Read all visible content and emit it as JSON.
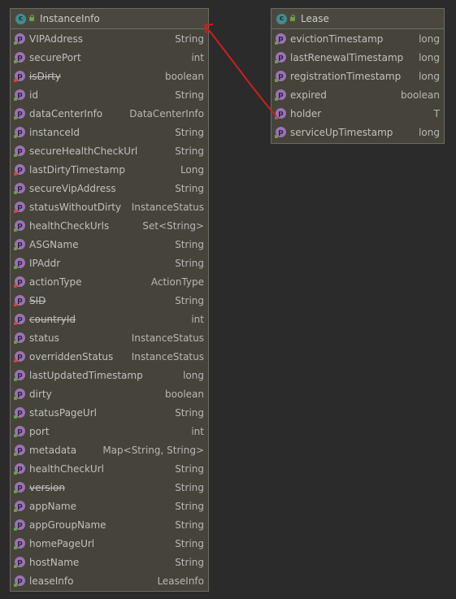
{
  "colors": {
    "background": "#2b2b2b",
    "class_box": "#45433a",
    "border": "#6d6c63",
    "class_icon": "#3d8d93",
    "property_icon": "#9a73b3",
    "arrow": "#c8201f"
  },
  "class_icon_letter": "c",
  "property_icon_letter": "p",
  "instance_info": {
    "title": "InstanceInfo",
    "fields": [
      {
        "name": "VIPAddress",
        "type": "String",
        "access": "public",
        "deprecated": false
      },
      {
        "name": "securePort",
        "type": "int",
        "access": "public",
        "deprecated": false
      },
      {
        "name": "isDirty",
        "type": "boolean",
        "access": "private",
        "deprecated": true
      },
      {
        "name": "id",
        "type": "String",
        "access": "public",
        "deprecated": false
      },
      {
        "name": "dataCenterInfo",
        "type": "DataCenterInfo",
        "access": "public",
        "deprecated": false
      },
      {
        "name": "instanceId",
        "type": "String",
        "access": "public",
        "deprecated": false
      },
      {
        "name": "secureHealthCheckUrl",
        "type": "String",
        "access": "public",
        "deprecated": false
      },
      {
        "name": "lastDirtyTimestamp",
        "type": "Long",
        "access": "private",
        "deprecated": false
      },
      {
        "name": "secureVipAddress",
        "type": "String",
        "access": "public",
        "deprecated": false
      },
      {
        "name": "statusWithoutDirty",
        "type": "InstanceStatus",
        "access": "private",
        "deprecated": false
      },
      {
        "name": "healthCheckUrls",
        "type": "Set<String>",
        "access": "public",
        "deprecated": false
      },
      {
        "name": "ASGName",
        "type": "String",
        "access": "public",
        "deprecated": false
      },
      {
        "name": "IPAddr",
        "type": "String",
        "access": "public",
        "deprecated": false
      },
      {
        "name": "actionType",
        "type": "ActionType",
        "access": "private",
        "deprecated": false
      },
      {
        "name": "SID",
        "type": "String",
        "access": "private",
        "deprecated": true
      },
      {
        "name": "countryId",
        "type": "int",
        "access": "private",
        "deprecated": true
      },
      {
        "name": "status",
        "type": "InstanceStatus",
        "access": "public",
        "deprecated": false
      },
      {
        "name": "overriddenStatus",
        "type": "InstanceStatus",
        "access": "private",
        "deprecated": false
      },
      {
        "name": "lastUpdatedTimestamp",
        "type": "long",
        "access": "public",
        "deprecated": false
      },
      {
        "name": "dirty",
        "type": "boolean",
        "access": "public",
        "deprecated": false
      },
      {
        "name": "statusPageUrl",
        "type": "String",
        "access": "public",
        "deprecated": false
      },
      {
        "name": "port",
        "type": "int",
        "access": "public",
        "deprecated": false
      },
      {
        "name": "metadata",
        "type": "Map<String, String>",
        "access": "public",
        "deprecated": false
      },
      {
        "name": "healthCheckUrl",
        "type": "String",
        "access": "public",
        "deprecated": false
      },
      {
        "name": "version",
        "type": "String",
        "access": "public",
        "deprecated": true
      },
      {
        "name": "appName",
        "type": "String",
        "access": "public",
        "deprecated": false
      },
      {
        "name": "appGroupName",
        "type": "String",
        "access": "public",
        "deprecated": false
      },
      {
        "name": "homePageUrl",
        "type": "String",
        "access": "public",
        "deprecated": false
      },
      {
        "name": "hostName",
        "type": "String",
        "access": "public",
        "deprecated": false
      },
      {
        "name": "leaseInfo",
        "type": "LeaseInfo",
        "access": "public",
        "deprecated": false
      }
    ]
  },
  "lease": {
    "title": "Lease",
    "fields": [
      {
        "name": "evictionTimestamp",
        "type": "long",
        "access": "public",
        "deprecated": false
      },
      {
        "name": "lastRenewalTimestamp",
        "type": "long",
        "access": "public",
        "deprecated": false
      },
      {
        "name": "registrationTimestamp",
        "type": "long",
        "access": "public",
        "deprecated": false
      },
      {
        "name": "expired",
        "type": "boolean",
        "access": "public",
        "deprecated": false
      },
      {
        "name": "holder",
        "type": "T",
        "access": "private",
        "deprecated": false
      },
      {
        "name": "serviceUpTimestamp",
        "type": "long",
        "access": "public",
        "deprecated": false
      }
    ]
  }
}
